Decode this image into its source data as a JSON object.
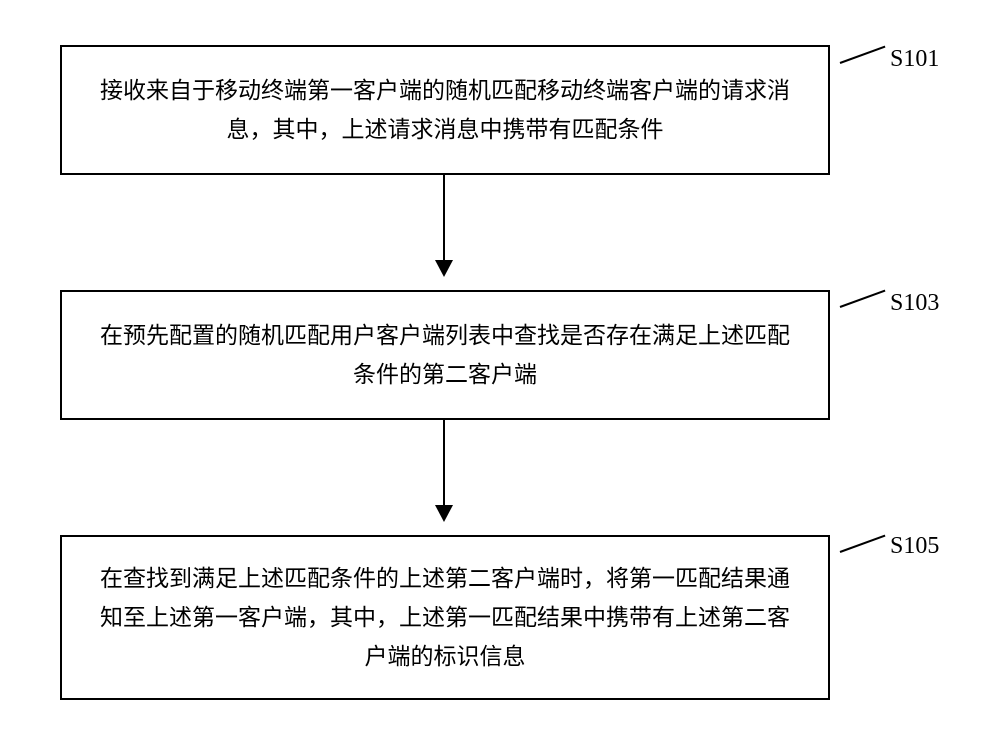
{
  "flowchart": {
    "steps": [
      {
        "label": "S101",
        "text": "接收来自于移动终端第一客户端的随机匹配移动终端客户端的请求消息，其中，上述请求消息中携带有匹配条件"
      },
      {
        "label": "S103",
        "text": "在预先配置的随机匹配用户客户端列表中查找是否存在满足上述匹配条件的第二客户端"
      },
      {
        "label": "S105",
        "text": "在查找到满足上述匹配条件的上述第二客户端时，将第一匹配结果通知至上述第一客户端，其中，上述第一匹配结果中携带有上述第二客户端的标识信息"
      }
    ]
  }
}
